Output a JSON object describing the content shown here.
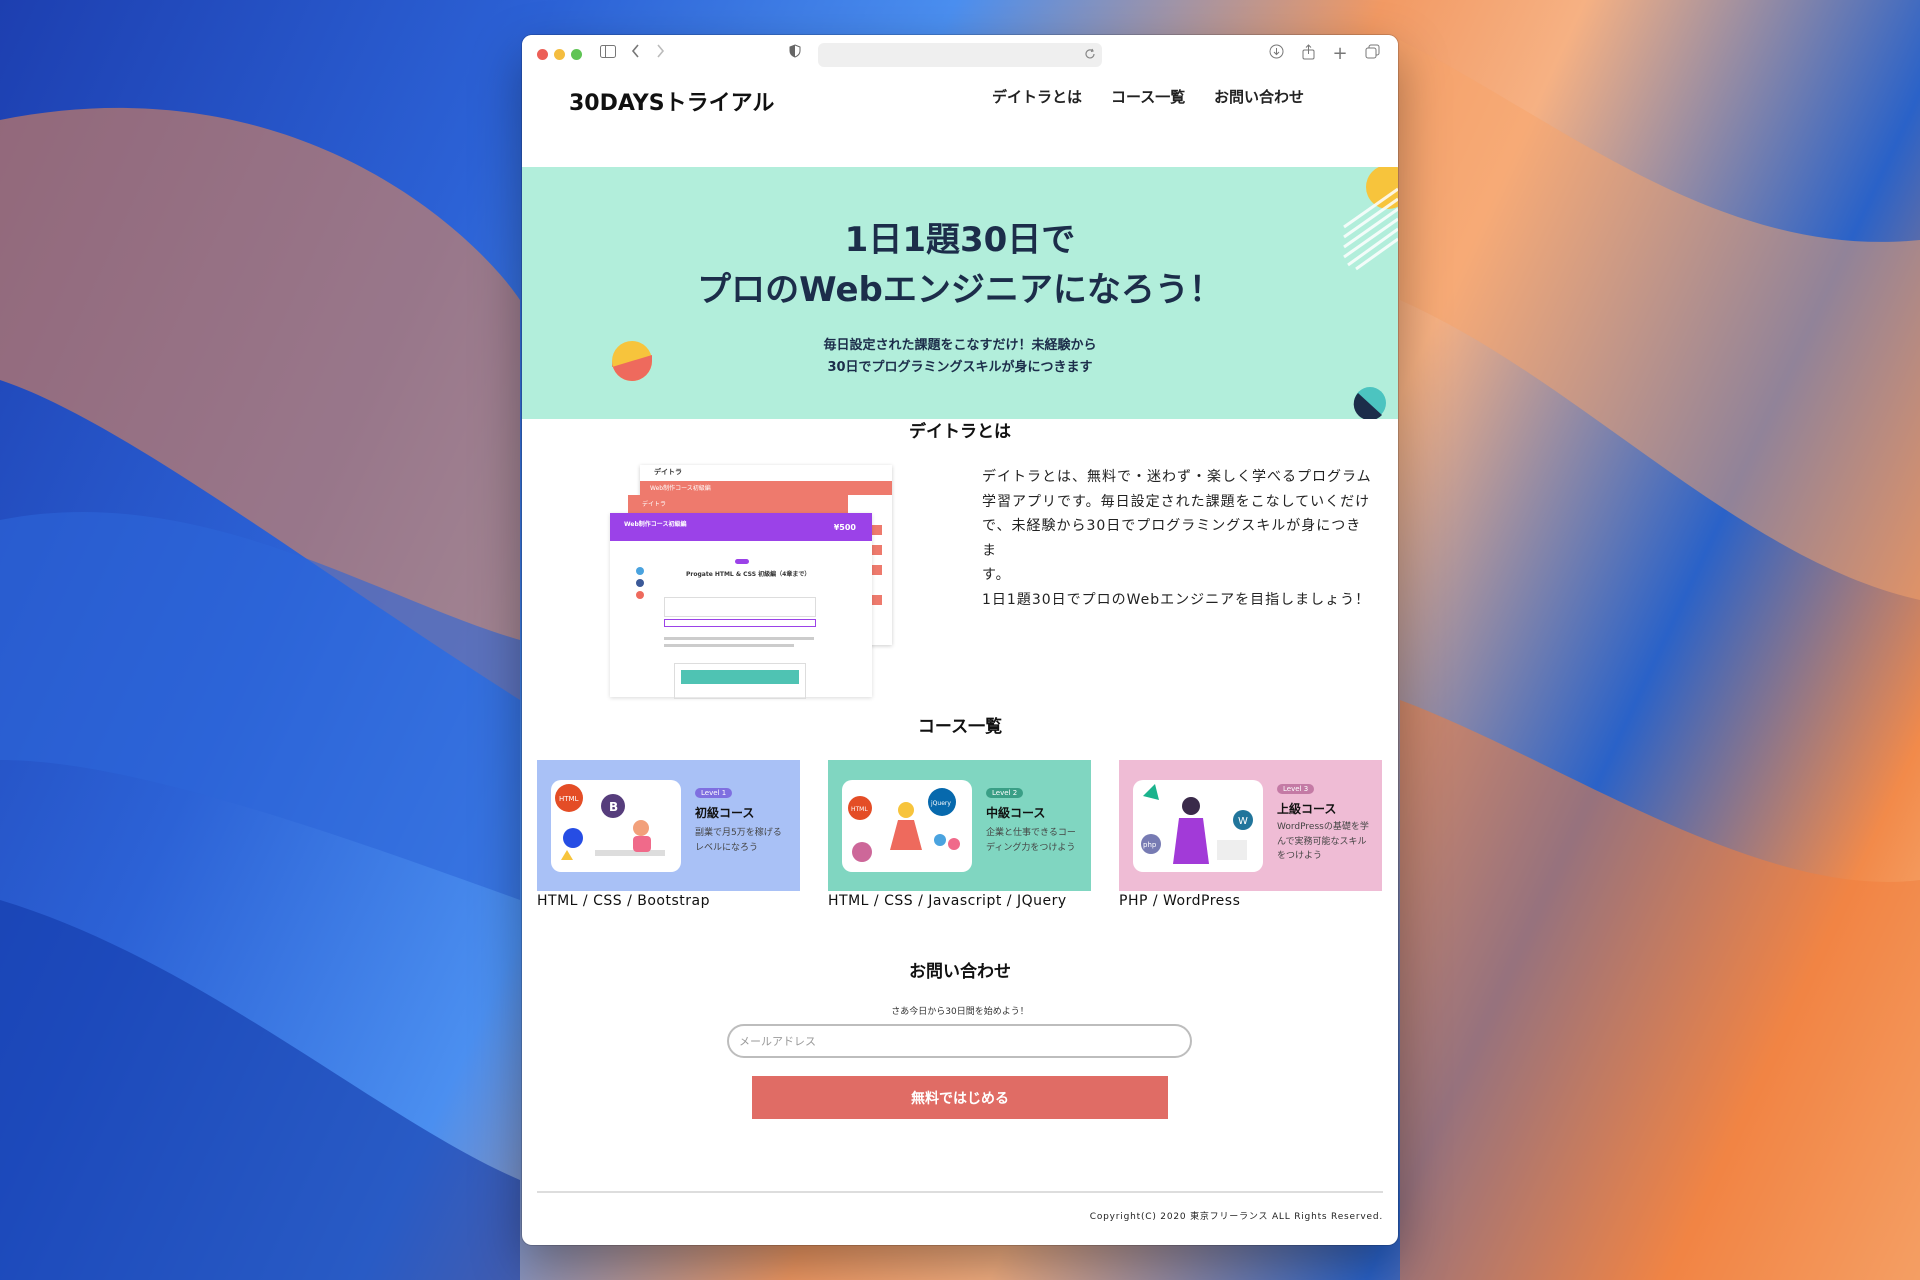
{
  "site": {
    "logo": "30DAYSトライアル",
    "nav": [
      "デイトラとは",
      "コース一覧",
      "お問い合わせ"
    ]
  },
  "hero": {
    "title_line1": "1日1題30日で",
    "title_line2": "プロのWebエンジニアになろう！",
    "sub_line1": "毎日設定された課題をこなすだけ！未経験から",
    "sub_line2": "30日でプログラミングスキルが身につきます"
  },
  "about": {
    "title": "デイトラとは",
    "body_line1": "デイトラとは、無料で・迷わず・楽しく学べるプログラム",
    "body_line2": "学習アプリです。毎日設定された課題をこなしていくだけ",
    "body_line3": "で、未経験から30日でプログラミングスキルが身につきま",
    "body_line4": "す。",
    "body_line5": "1日1題30日でプロのWebエンジニアを目指しましょう！",
    "mock_brand": "デイトラ",
    "mock_banner1": "Web制作コース初級編",
    "mock_banner2": "Web制作コース初級編",
    "mock_price": "¥500",
    "mock_heading": "Progate HTML & CSS 初級編（4章まで）"
  },
  "courses": {
    "title": "コース一覧",
    "items": [
      {
        "level": "Level 1",
        "name": "初級コース",
        "desc": "副業で月5万を稼げるレベルになろう",
        "label": "HTML / CSS / Bootstrap",
        "bg": "#a9c1f6",
        "badge": "#7f6fe0"
      },
      {
        "level": "Level 2",
        "name": "中級コース",
        "desc": "企業と仕事できるコーディング力をつけよう",
        "label": "HTML / CSS / Javascript / JQuery",
        "bg": "#80d6c1",
        "badge": "#3a9f86"
      },
      {
        "level": "Level 3",
        "name": "上級コース",
        "desc": "WordPressの基礎を学んで実務可能なスキルをつけよう",
        "label": "PHP / WordPress",
        "bg": "#efbcd5",
        "badge": "#c47aa5"
      }
    ]
  },
  "contact": {
    "title": "お問い合わせ",
    "note": "さあ今日から30日間を始めよう！",
    "email_placeholder": "メールアドレス",
    "button": "無料ではじめる"
  },
  "footer": {
    "copyright": "Copyright(C) 2020 東京フリーランス ALL Rights Reserved."
  },
  "colors": {
    "hero_bg": "#b2eedb",
    "accent": "#e06c65",
    "heading": "#1c2d4a"
  }
}
